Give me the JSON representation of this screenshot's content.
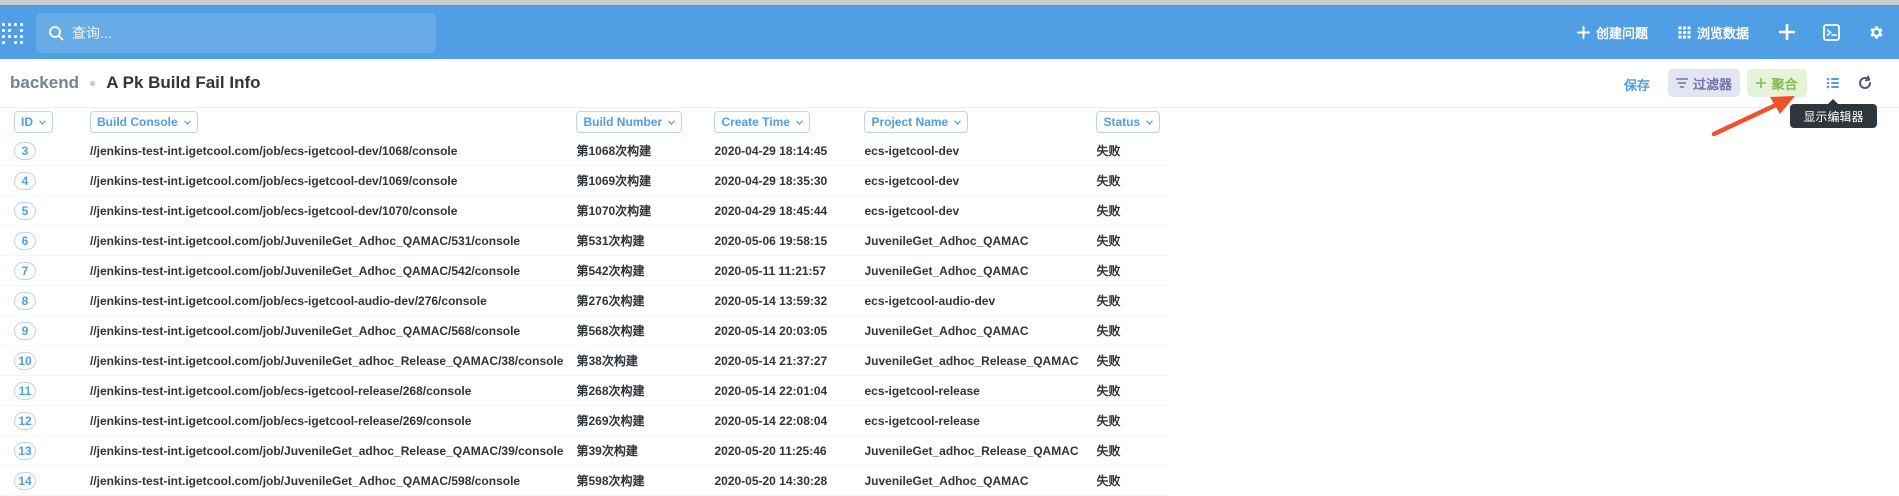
{
  "nav": {
    "search_placeholder": "查询...",
    "create_question": "创建问题",
    "browse_data": "浏览数据"
  },
  "header": {
    "database": "backend",
    "title": "A Pk Build Fail Info",
    "save": "保存",
    "filter": "过滤器",
    "summarize": "聚合",
    "tooltip": "显示编辑器"
  },
  "table": {
    "columns": [
      "ID",
      "Build Console",
      "Build Number",
      "Create Time",
      "Project Name",
      "Status"
    ],
    "rows": [
      [
        "3",
        "//jenkins-test-int.igetcool.com/job/ecs-igetcool-dev/1068/console",
        "第1068次构建",
        "2020-04-29 18:14:45",
        "ecs-igetcool-dev",
        "失败"
      ],
      [
        "4",
        "//jenkins-test-int.igetcool.com/job/ecs-igetcool-dev/1069/console",
        "第1069次构建",
        "2020-04-29 18:35:30",
        "ecs-igetcool-dev",
        "失败"
      ],
      [
        "5",
        "//jenkins-test-int.igetcool.com/job/ecs-igetcool-dev/1070/console",
        "第1070次构建",
        "2020-04-29 18:45:44",
        "ecs-igetcool-dev",
        "失败"
      ],
      [
        "6",
        "//jenkins-test-int.igetcool.com/job/JuvenileGet_Adhoc_QAMAC/531/console",
        "第531次构建",
        "2020-05-06 19:58:15",
        "JuvenileGet_Adhoc_QAMAC",
        "失败"
      ],
      [
        "7",
        "//jenkins-test-int.igetcool.com/job/JuvenileGet_Adhoc_QAMAC/542/console",
        "第542次构建",
        "2020-05-11 11:21:57",
        "JuvenileGet_Adhoc_QAMAC",
        "失败"
      ],
      [
        "8",
        "//jenkins-test-int.igetcool.com/job/ecs-igetcool-audio-dev/276/console",
        "第276次构建",
        "2020-05-14 13:59:32",
        "ecs-igetcool-audio-dev",
        "失败"
      ],
      [
        "9",
        "//jenkins-test-int.igetcool.com/job/JuvenileGet_Adhoc_QAMAC/568/console",
        "第568次构建",
        "2020-05-14 20:03:05",
        "JuvenileGet_Adhoc_QAMAC",
        "失败"
      ],
      [
        "10",
        "//jenkins-test-int.igetcool.com/job/JuvenileGet_adhoc_Release_QAMAC/38/console",
        "第38次构建",
        "2020-05-14 21:37:27",
        "JuvenileGet_adhoc_Release_QAMAC",
        "失败"
      ],
      [
        "11",
        "//jenkins-test-int.igetcool.com/job/ecs-igetcool-release/268/console",
        "第268次构建",
        "2020-05-14 22:01:04",
        "ecs-igetcool-release",
        "失败"
      ],
      [
        "12",
        "//jenkins-test-int.igetcool.com/job/ecs-igetcool-release/269/console",
        "第269次构建",
        "2020-05-14 22:08:04",
        "ecs-igetcool-release",
        "失败"
      ],
      [
        "13",
        "//jenkins-test-int.igetcool.com/job/JuvenileGet_adhoc_Release_QAMAC/39/console",
        "第39次构建",
        "2020-05-20 11:25:46",
        "JuvenileGet_adhoc_Release_QAMAC",
        "失败"
      ],
      [
        "14",
        "//jenkins-test-int.igetcool.com/job/JuvenileGet_Adhoc_QAMAC/598/console",
        "第598次构建",
        "2020-05-20 14:30:28",
        "JuvenileGet_Adhoc_QAMAC",
        "失败"
      ]
    ]
  },
  "colors": {
    "brand": "#509ee3",
    "filter": "#7172ad",
    "summarize": "#84bb4c",
    "annotation_arrow": "#f0512b"
  }
}
